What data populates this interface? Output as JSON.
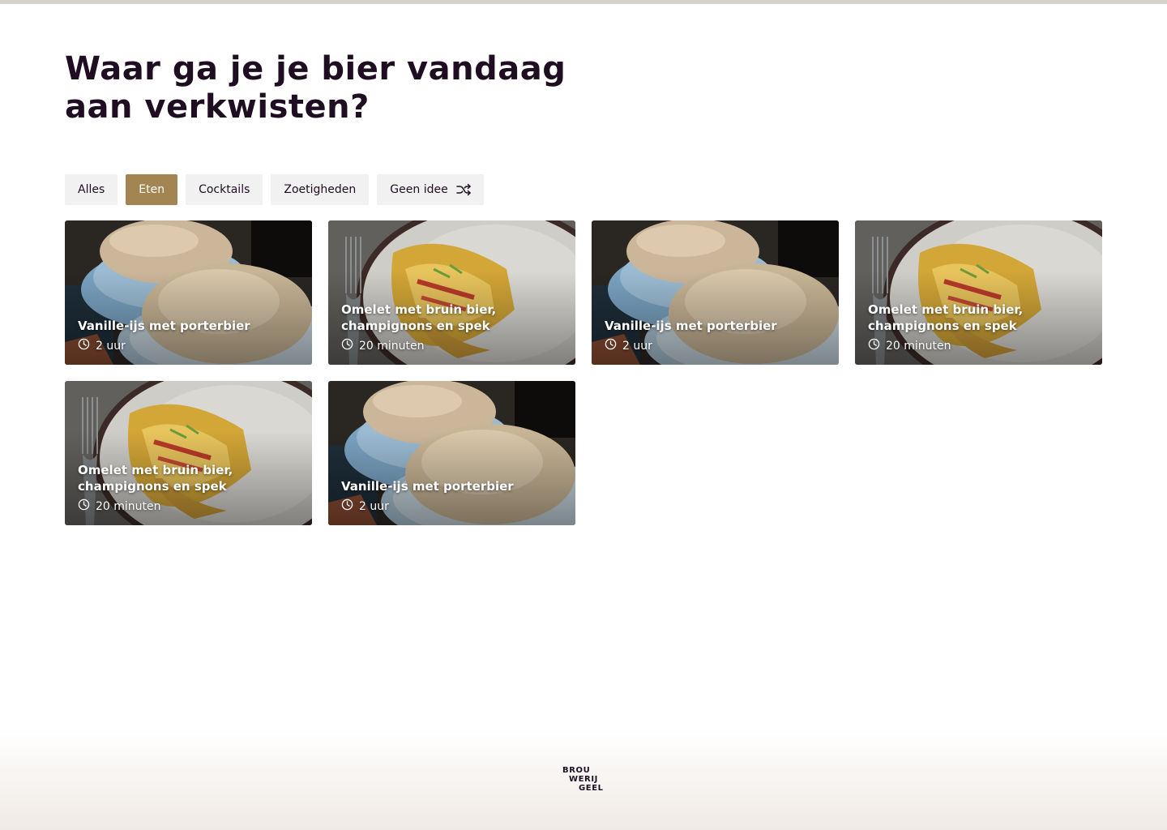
{
  "page": {
    "title": "Waar ga je je bier vandaag aan verkwisten?"
  },
  "filters": [
    {
      "label": "Alles",
      "active": false
    },
    {
      "label": "Eten",
      "active": true
    },
    {
      "label": "Cocktails",
      "active": false
    },
    {
      "label": "Zoetigheden",
      "active": false
    },
    {
      "label": "Geen idee",
      "active": false,
      "icon": "shuffle-icon"
    }
  ],
  "recipes": [
    {
      "title": "Vanille-ijs met porterbier",
      "time": "2 uur",
      "image": "ice-cream"
    },
    {
      "title": "Omelet met bruin bier, champignons en spek",
      "time": "20 minuten",
      "image": "omelet"
    },
    {
      "title": "Vanille-ijs met porterbier",
      "time": "2 uur",
      "image": "ice-cream"
    },
    {
      "title": "Omelet met bruin bier, champignons en spek",
      "time": "20 minuten",
      "image": "omelet"
    },
    {
      "title": "Omelet met bruin bier, champignons en spek",
      "time": "20 minuten",
      "image": "omelet"
    },
    {
      "title": "Vanille-ijs met porterbier",
      "time": "2 uur",
      "image": "ice-cream"
    }
  ],
  "footer": {
    "logo_lines": [
      "BROU",
      "WERIJ",
      "GEEL"
    ]
  },
  "colors": {
    "text": "#1f0e22",
    "accent": "#a38551",
    "chip_bg": "#f2f1f1"
  }
}
